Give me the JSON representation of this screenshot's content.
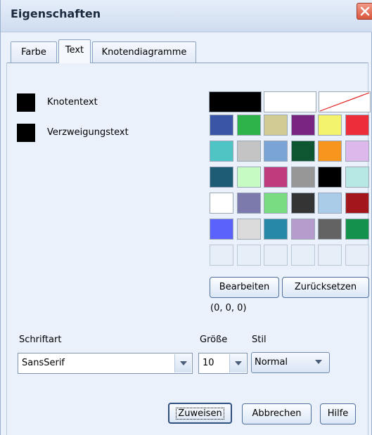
{
  "dialog": {
    "title": "Eigenschaften"
  },
  "tabs": [
    {
      "label": "Farbe"
    },
    {
      "label": "Text"
    },
    {
      "label": "Knotendiagramme"
    }
  ],
  "color_targets": [
    {
      "label": "Knotentext",
      "color": "#000000"
    },
    {
      "label": "Verzweigungstext",
      "color": "#000000"
    }
  ],
  "palette": {
    "top": [
      "#000000",
      "#ffffff",
      "none"
    ],
    "grid": [
      [
        "#3a55a6",
        "#2eb24a",
        "#d2cb93",
        "#7b2582",
        "#f4f36c",
        "#ed2e3a"
      ],
      [
        "#4ec4c4",
        "#c4c4c4",
        "#7aa3d6",
        "#0d5631",
        "#f7951e",
        "#ddb8ea"
      ],
      [
        "#1d5c74",
        "#c6fcc4",
        "#c03b7d",
        "#979797",
        "#000000",
        "#b8e8e4"
      ],
      [
        "#ffffff",
        "#7c7aac",
        "#79dc83",
        "#343434",
        "#aacce9",
        "#a3161b"
      ],
      [
        "#5b62fb",
        "#dbdbdb",
        "#2789a7",
        "#b69ccd",
        "#636363",
        "#14914a"
      ],
      [
        "",
        "",
        "",
        "",
        "",
        ""
      ]
    ]
  },
  "buttons": {
    "edit": "Bearbeiten",
    "reset": "Zurücksetzen",
    "apply": "Zuweisen",
    "cancel": "Abbrechen",
    "help": "Hilfe"
  },
  "rgb_readout": "(0, 0, 0)",
  "font": {
    "family_label": "Schriftart",
    "family_value": "SansSerif",
    "size_label": "Größe",
    "size_value": "10",
    "style_label": "Stil",
    "style_value": "Normal"
  }
}
